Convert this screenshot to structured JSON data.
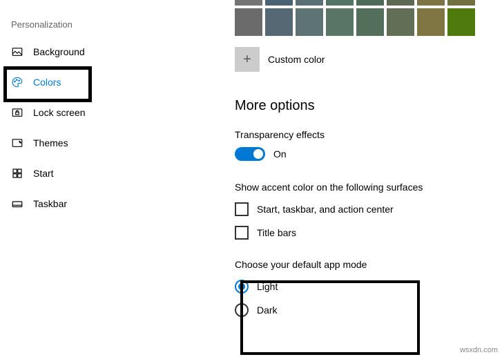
{
  "sidebar": {
    "title": "Personalization",
    "items": [
      {
        "label": "Background"
      },
      {
        "label": "Colors"
      },
      {
        "label": "Lock screen"
      },
      {
        "label": "Themes"
      },
      {
        "label": "Start"
      },
      {
        "label": "Taskbar"
      }
    ]
  },
  "palette": {
    "row1": [
      "#747474",
      "#4a6273",
      "#5a7074",
      "#537367",
      "#4f6a59",
      "#5e6954",
      "#7c7445",
      "#707041"
    ],
    "row2": [
      "#6b6b6b",
      "#556873",
      "#5d7374",
      "#587566",
      "#536e5b",
      "#636e56",
      "#807644",
      "#4f7b0e"
    ]
  },
  "custom_color": {
    "plus": "+",
    "label": "Custom color"
  },
  "more_options": "More options",
  "transparency": {
    "label": "Transparency effects",
    "state": "On"
  },
  "accent_surfaces": {
    "label": "Show accent color on the following surfaces",
    "options": [
      "Start, taskbar, and action center",
      "Title bars"
    ]
  },
  "app_mode": {
    "label": "Choose your default app mode",
    "options": [
      "Light",
      "Dark"
    ]
  },
  "watermark": "wsxdn.com"
}
